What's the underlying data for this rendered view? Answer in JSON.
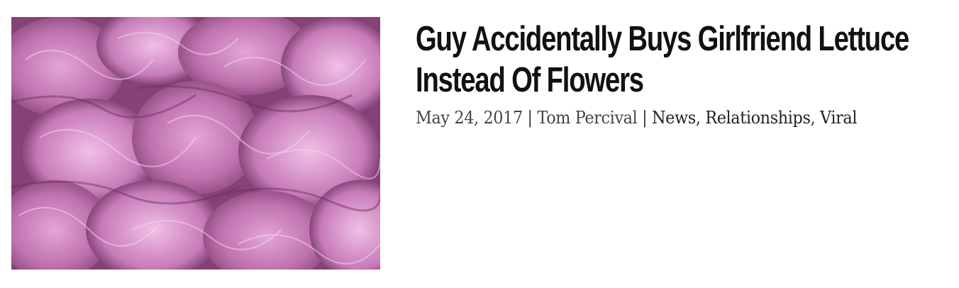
{
  "post": {
    "title_line1": "Guy Accidentally Buys Girlfriend Lettuce",
    "title_line2": "Instead Of Flowers",
    "date": "May 24, 2017",
    "separator": "|",
    "author": "Tom Percival",
    "categories": [
      "News",
      "Relationships",
      "Viral"
    ],
    "category_separator": ",",
    "image_alt": "purple lettuce leaves photo"
  },
  "colors": {
    "title": "#111111",
    "meta": "#444444",
    "image_primary": "#b86aa6",
    "image_dark": "#5a2a4e"
  }
}
